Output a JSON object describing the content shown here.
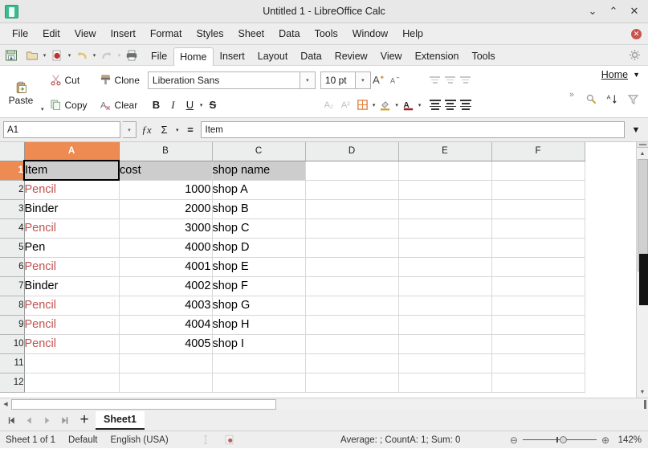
{
  "titlebar": {
    "title": "Untitled 1 - LibreOffice Calc",
    "logo_icon": "calc-app-icon",
    "minimize": "⌄",
    "maximize": "⌃",
    "close": "✕"
  },
  "menubar": {
    "items": [
      {
        "label": "File",
        "accel": "F"
      },
      {
        "label": "Edit",
        "accel": "E"
      },
      {
        "label": "View",
        "accel": "V"
      },
      {
        "label": "Insert",
        "accel": "I"
      },
      {
        "label": "Format",
        "accel": "o"
      },
      {
        "label": "Styles",
        "accel": "y"
      },
      {
        "label": "Sheet",
        "accel": "S"
      },
      {
        "label": "Data",
        "accel": "D"
      },
      {
        "label": "Tools",
        "accel": "T"
      },
      {
        "label": "Window",
        "accel": "W"
      },
      {
        "label": "Help",
        "accel": "H"
      }
    ],
    "close_doc": "✕"
  },
  "quicktoolbar": {
    "icons": [
      "save-icon",
      "open-icon",
      "export-pdf-icon",
      "undo-icon",
      "redo-icon",
      "print-icon"
    ],
    "dropdown_caret": "▾"
  },
  "notebookbar": {
    "tabs": [
      {
        "label": "File",
        "active": false
      },
      {
        "label": "Home",
        "active": true
      },
      {
        "label": "Insert",
        "active": false
      },
      {
        "label": "Layout",
        "active": false
      },
      {
        "label": "Data",
        "active": false
      },
      {
        "label": "Review",
        "active": false
      },
      {
        "label": "View",
        "active": false
      },
      {
        "label": "Extension",
        "active": false
      },
      {
        "label": "Tools",
        "active": false
      }
    ],
    "settings_icon": "gear-icon"
  },
  "ribbon": {
    "paste_label": "Paste",
    "cut_label": "Cut",
    "copy_label": "Copy",
    "clone_label": "Clone",
    "clear_label": "Clear",
    "font_name": "Liberation Sans",
    "font_size": "10 pt",
    "bold": "B",
    "italic": "I",
    "underline": "U",
    "strikethrough": "S",
    "increase_size": "A",
    "decrease_size": "A",
    "subscript": "A₂",
    "superscript": "A²",
    "borders_icon": "borders-icon",
    "background_color_icon": "highlight-color-icon",
    "font_color_icon": "font-color-icon",
    "more_caret": "»",
    "home_menu_label": "Home",
    "home_menu_caret": "▼",
    "find_replace_icon": "find-replace-icon",
    "sort_icon": "sort-ascending-icon",
    "filter_icon": "autofilter-icon"
  },
  "formulabar": {
    "name_box": "A1",
    "function_wizard": "ƒx",
    "sum_icon": "Σ",
    "formula_icon": "=",
    "input_line": "Item",
    "expand_icon": "▼"
  },
  "grid": {
    "columns": [
      "A",
      "B",
      "C",
      "D",
      "E",
      "F"
    ],
    "selected_column": "A",
    "selected_row": "1",
    "active_cell": "A1",
    "rows": [
      {
        "num": "1",
        "a": "Item",
        "b": "cost",
        "c": "shop name",
        "header": true,
        "a_red": false
      },
      {
        "num": "2",
        "a": "Pencil",
        "b": "1000",
        "c": "shop A",
        "header": false,
        "a_red": true
      },
      {
        "num": "3",
        "a": "Binder",
        "b": "2000",
        "c": "shop B",
        "header": false,
        "a_red": false
      },
      {
        "num": "4",
        "a": "Pencil",
        "b": "3000",
        "c": "shop C",
        "header": false,
        "a_red": true
      },
      {
        "num": "5",
        "a": "Pen",
        "b": "4000",
        "c": "shop D",
        "header": false,
        "a_red": false
      },
      {
        "num": "6",
        "a": "Pencil",
        "b": "4001",
        "c": "shop E",
        "header": false,
        "a_red": true
      },
      {
        "num": "7",
        "a": "Binder",
        "b": "4002",
        "c": "shop F",
        "header": false,
        "a_red": false
      },
      {
        "num": "8",
        "a": "Pencil",
        "b": "4003",
        "c": "shop G",
        "header": false,
        "a_red": true
      },
      {
        "num": "9",
        "a": "Pencil",
        "b": "4004",
        "c": "shop H",
        "header": false,
        "a_red": true
      },
      {
        "num": "10",
        "a": "Pencil",
        "b": "4005",
        "c": "shop I",
        "header": false,
        "a_red": true
      },
      {
        "num": "11",
        "a": "",
        "b": "",
        "c": "",
        "header": false,
        "a_red": false
      },
      {
        "num": "12",
        "a": "",
        "b": "",
        "c": "",
        "header": false,
        "a_red": false
      }
    ],
    "red_text_color": "#c0504d",
    "header_fill_color": "#cdcdcd",
    "selection_color": "#ee8b52"
  },
  "tabbar": {
    "first_icon": "⏮",
    "prev_icon": "◀",
    "next_icon": "▶",
    "last_icon": "⏭",
    "add_sheet_icon": "+",
    "sheets": [
      {
        "label": "Sheet1",
        "active": true
      }
    ]
  },
  "statusbar": {
    "sheet_info": "Sheet 1 of 1",
    "page_style": "Default",
    "language": "English (USA)",
    "selection_mode_icon": "selection-mode-icon",
    "modified_icon": "document-modified-icon",
    "signature_icon": "digital-signature-icon",
    "summary": "Average: ; CountA: 1; Sum: 0",
    "zoom_out": "⊖",
    "zoom_in": "⊕",
    "zoom_level": "142%"
  }
}
